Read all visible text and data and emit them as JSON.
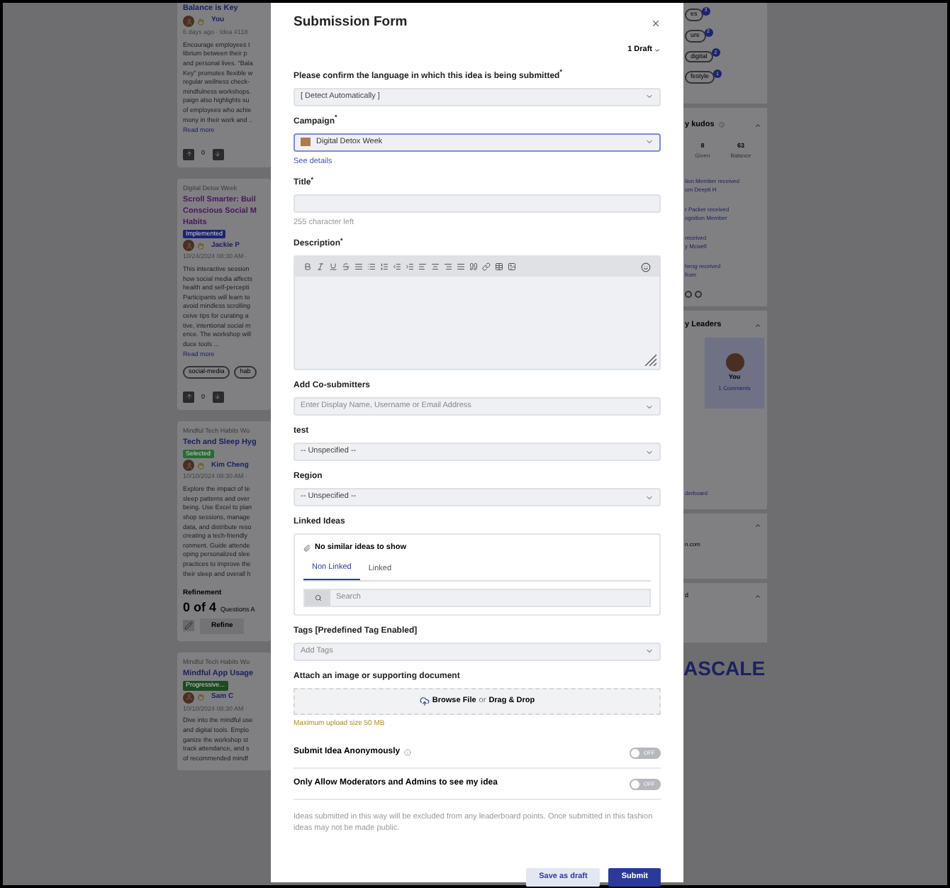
{
  "background": {
    "left_cards": [
      {
        "title_lines": [
          "Balance is Key"
        ],
        "author": "You",
        "meta": "6 days ago · Idea #118",
        "description_lines": [
          "Encourage employees t",
          "librium between their p",
          "and personal lives. \"Bala",
          "Key\" promotes flexible w",
          "regular wellness check-",
          "mindfulness workshops.",
          "paign also highlights su",
          "of employees who achie",
          "mony in their work and .."
        ],
        "read_more": "Read more",
        "votes": "0"
      },
      {
        "category": "Digital Detox Week",
        "title_lines": [
          "Scroll Smarter: Buil",
          "Conscious Social M",
          "Habits"
        ],
        "badge": {
          "text": "Implemented",
          "color": "#1c2470"
        },
        "author": "Jackie P",
        "meta": "10/24/2024 08:30 AM ·",
        "description_lines": [
          "This interactive session",
          "how social media affects",
          "health and self-percepti",
          "Participants will learn to",
          "avoid mindless scrolling",
          "ceive tips for curating a",
          "tive, intentional social m",
          "ence. The workshop will",
          "duce tools ..."
        ],
        "read_more": "Read more",
        "tags": [
          "social-media",
          "hab"
        ],
        "votes": "0"
      },
      {
        "category": "Mindful Tech Habits Wo",
        "title_lines": [
          "Tech and Sleep Hyg"
        ],
        "badge": {
          "text": "Selected",
          "color": "#2a6a34"
        },
        "author": "Kim Cheng",
        "meta": "10/10/2024 08:30 AM ·",
        "description_lines": [
          "Explore the impact of te",
          "sleep patterns and over",
          "being. Use Excel to plan",
          "shop sessions, manage",
          "data, and distribute reso",
          "creating a tech-friendly",
          "ronment. Guide attende",
          "oping personalized slee",
          "practices to improve the",
          "their sleep and overall h"
        ],
        "refinement": {
          "label": "Refinement",
          "count": "0 of 4",
          "caption": "Questions A",
          "button": "Refine"
        }
      },
      {
        "category": "Mindful Tech Habits Wo",
        "title_lines": [
          "Mindful App Usage"
        ],
        "badge": {
          "text": "Progressive...",
          "color": "#1c4a22"
        },
        "author": "Sam C",
        "meta": "10/10/2024 08:30 AM ·",
        "description_lines": [
          "Dive into the mindful use",
          "and digital tools. Emplo",
          "ganize the workshop st",
          "track attendance, and s",
          "of recommended mindf"
        ]
      }
    ],
    "right_panels": {
      "tags": [
        {
          "text": "es",
          "count": "3"
        },
        {
          "text": "ure",
          "count": "2"
        },
        {
          "text": "digital",
          "count": "2"
        },
        {
          "text": "festyle",
          "count": "1"
        }
      ],
      "kudos": {
        "title": "y kudos",
        "stats": [
          {
            "value": "8",
            "label": "Given"
          },
          {
            "value": "63",
            "label": "Balance"
          }
        ],
        "feed": [
          [
            "tion Member received",
            "om Deepti H"
          ],
          [
            "r Packer received",
            "ognition Member"
          ],
          [
            "received",
            "y Mcwell"
          ],
          [
            "heng received",
            "from"
          ]
        ]
      },
      "leaders": {
        "title": "y Leaders",
        "name": "You",
        "caption": "1 Comments",
        "link": "derboard"
      },
      "link_card": "n.com",
      "mini_card": "d",
      "logo": "ASCALE"
    }
  },
  "modal": {
    "title": "Submission Form",
    "draft_menu": "1 Draft",
    "fields": [
      {
        "kind": "select",
        "label": "Please confirm the language in which this idea is being submitted$^{*}$",
        "value": "[ Detect Automatically ]"
      },
      {
        "kind": "campaign",
        "label": "Campaign$^{*}$",
        "value": "Digital Detox Week",
        "focused": true,
        "link": "See details"
      },
      {
        "kind": "input",
        "label": "Title$^{*}$",
        "hint": "255 character left"
      },
      {
        "kind": "editor",
        "label": "Description$^{*}$"
      },
      {
        "kind": "select",
        "label": "Add Co-submitters",
        "placeholder": "Enter Display Name, Username or Email Address"
      },
      {
        "kind": "select",
        "label": "test",
        "value": "-- Unspecified --"
      },
      {
        "kind": "select",
        "label": "Region",
        "value": "-- Unspecified --"
      },
      {
        "kind": "linked",
        "label": "Linked Ideas",
        "message": "No similar ideas to show",
        "tabs": [
          {
            "label": "Non Linked",
            "selected": true
          },
          {
            "label": "Linked",
            "selected": false
          }
        ],
        "search_placeholder": "Search"
      },
      {
        "kind": "select",
        "label": "Tags [Predefined Tag Enabled]",
        "placeholder": "Add Tags"
      },
      {
        "kind": "upload",
        "label": "Attach an image or supporting document",
        "browse": "Browse File",
        "or": "or",
        "drag": "Drag & Drop",
        "hint": "Maximum upload size 50 MB"
      }
    ],
    "toggles": [
      {
        "label": "Submit Idea Anonymously",
        "info": true,
        "on": false,
        "state": "OFF"
      },
      {
        "label": "Only Allow Moderators and Admins to see my idea",
        "info": false,
        "on": false,
        "state": "OFF"
      }
    ],
    "note": "Ideas submitted in this way will be excluded from any leaderboard points. Once submitted in this fashion ideas may not be made public.",
    "buttons": [
      {
        "kind": "secondary",
        "label": "Save as draft"
      },
      {
        "kind": "primary",
        "label": "Submit"
      }
    ]
  }
}
